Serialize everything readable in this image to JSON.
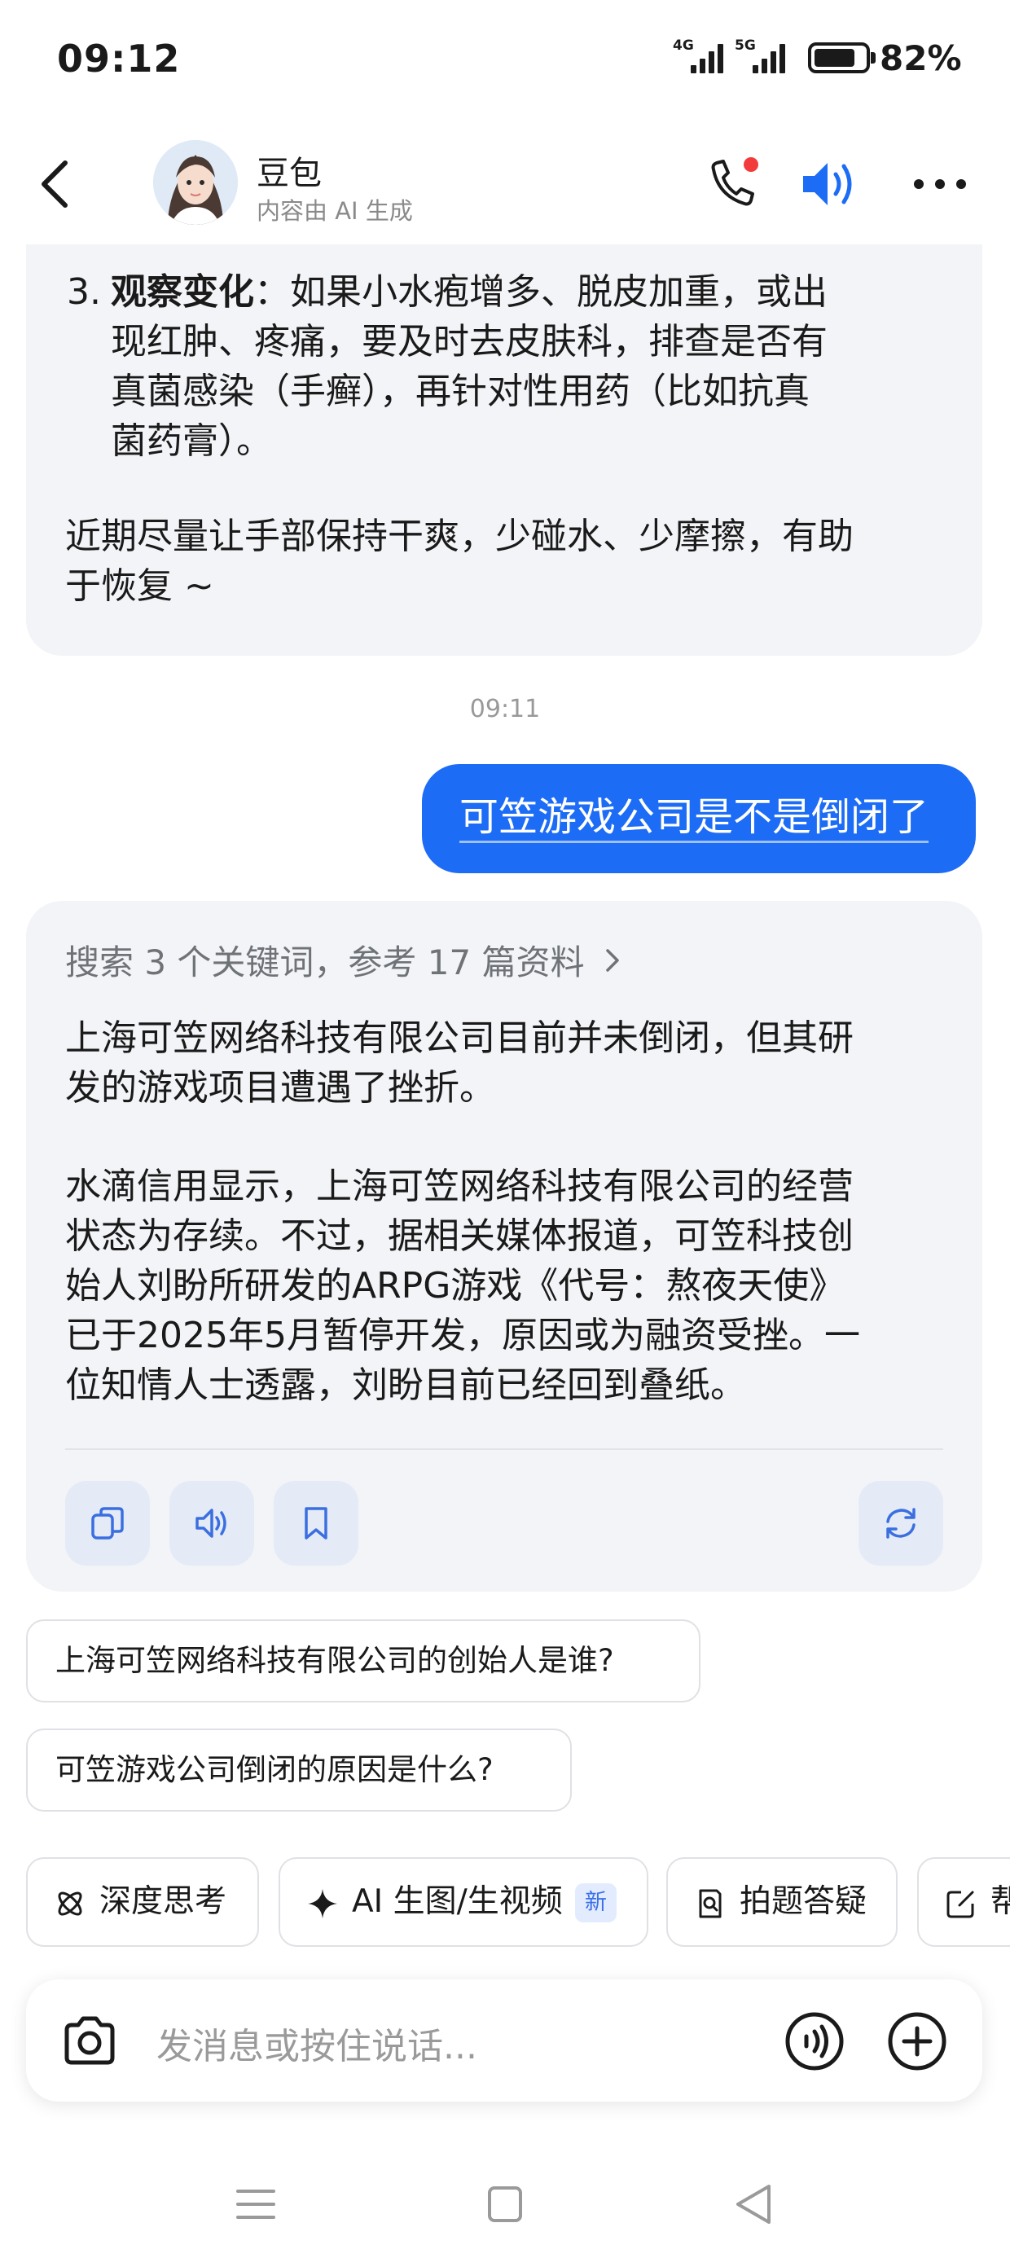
{
  "status_bar": {
    "time": "09:12",
    "net1_label": "4G",
    "net2_label": "5G",
    "battery_percent": "82%",
    "battery_level": 0.82
  },
  "header": {
    "bot_name": "豆包",
    "bot_subtitle": "内容由 AI 生成",
    "icons": [
      "back-icon",
      "phone-call-icon",
      "speaker-icon",
      "more-icon"
    ],
    "call_indicator_color": "#f23c3c",
    "speaker_color": "#1d6cf5"
  },
  "messages": {
    "prev_answer": {
      "item3_number": "3.",
      "item3_heading": "观察变化",
      "item3_line1": "：如果小水疱增多、脱皮加重，或出",
      "item3_line2": "现红肿、疼痛，要及时去皮肤科，排查是否有",
      "item3_line3": "真菌感染（手癣），再针对性用药（比如抗真",
      "item3_line4": "菌药膏）。",
      "closing_line1": "近期尽量让手部保持干爽，少碰水、少摩擦，有助",
      "closing_line2": "于恢复 ~"
    },
    "timestamp": "09:11",
    "user_question": "可笠游戏公司是不是倒闭了",
    "answer": {
      "search_summary": "搜索 3 个关键词，参考 17 篇资料",
      "para1_line1": "上海可笠网络科技有限公司目前并未倒闭，但其研",
      "para1_line2": "发的游戏项目遭遇了挫折。",
      "para2_line1": "水滴信用显示，上海可笠网络科技有限公司的经营",
      "para2_line2": "状态为存续。不过，据相关媒体报道，可笠科技创",
      "para2_line3": "始人刘盼所研发的ARPG游戏《代号：熬夜天使》",
      "para2_line4": "已于2025年5月暂停开发，原因或为融资受挫。一",
      "para2_line5": "位知情人士透露，刘盼目前已经回到叠纸。",
      "action_icons": [
        "copy-icon",
        "read-aloud-icon",
        "bookmark-icon",
        "regenerate-icon"
      ]
    }
  },
  "suggestions": [
    "上海可笠网络科技有限公司的创始人是谁?",
    "可笠游戏公司倒闭的原因是什么?"
  ],
  "chips": {
    "deep_think": "深度思考",
    "ai_gen": "AI 生图/生视频",
    "new_badge": "新",
    "photo_qa": "拍题答疑",
    "partial": "帮"
  },
  "composer": {
    "placeholder": "发消息或按住说话...",
    "icons": [
      "camera-icon",
      "voice-input-icon",
      "plus-icon"
    ]
  },
  "nav": {
    "icons": [
      "menu-nav-icon",
      "home-nav-icon",
      "back-nav-icon"
    ]
  },
  "colors": {
    "accent": "#1d6cf5",
    "bubble_bg": "#f3f4f7",
    "action_btn_bg": "#e4ebf7"
  }
}
